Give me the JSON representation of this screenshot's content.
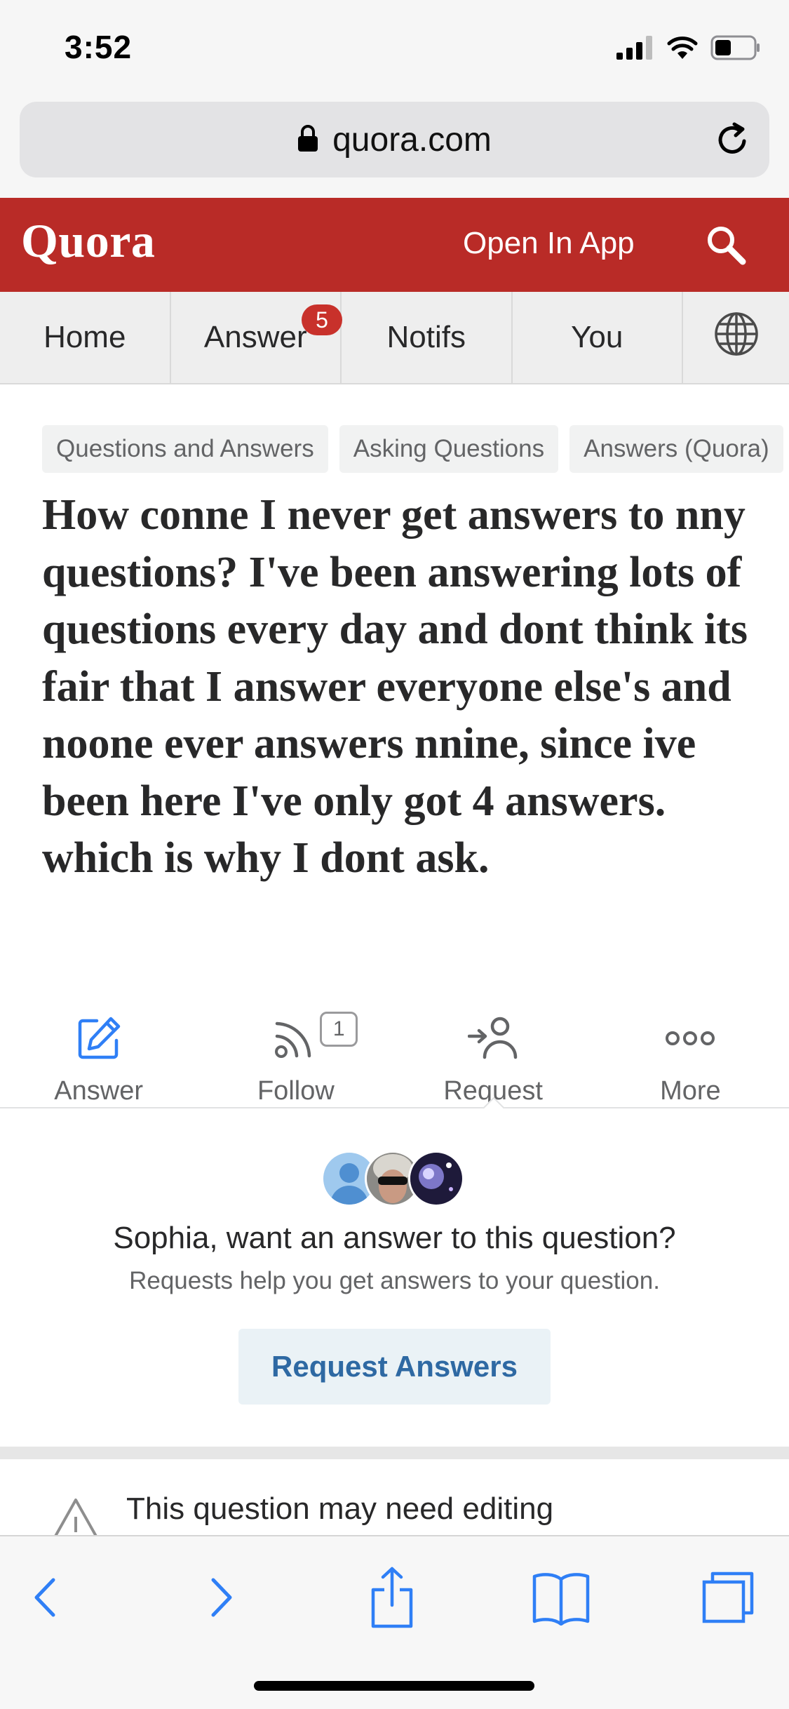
{
  "status_bar": {
    "time": "3:52"
  },
  "browser": {
    "url": "quora.com"
  },
  "quora_header": {
    "logo": "Quora",
    "open_in_app": "Open In App"
  },
  "nav": {
    "tabs": [
      {
        "label": "Home"
      },
      {
        "label": "Answer"
      },
      {
        "label": "Notifs"
      },
      {
        "label": "You"
      }
    ],
    "answer_badge": "5"
  },
  "topics": [
    "Questions and Answers",
    "Asking Questions",
    "Answers (Quora)"
  ],
  "question": {
    "text": "How conne I never get answers to nny questions? I've been answering lots of questions every day and dont think its fair that I answer everyone else's and noone ever answers nnine, since ive been here I've only got 4 answers. which is why I dont ask."
  },
  "actions": {
    "answer": "Answer",
    "follow": "Follow",
    "follow_count": "1",
    "request": "Request",
    "more": "More"
  },
  "request_panel": {
    "title": "Sophia, want an answer to this question?",
    "subtitle": "Requests help you get answers to your question.",
    "button": "Request Answers"
  },
  "edit_notice": {
    "text": "This question may need editing"
  },
  "colors": {
    "quora_red": "#b92b27",
    "badge_red": "#c8312b",
    "ios_blue": "#2f7ff6",
    "request_blue": "#2e69a3"
  }
}
